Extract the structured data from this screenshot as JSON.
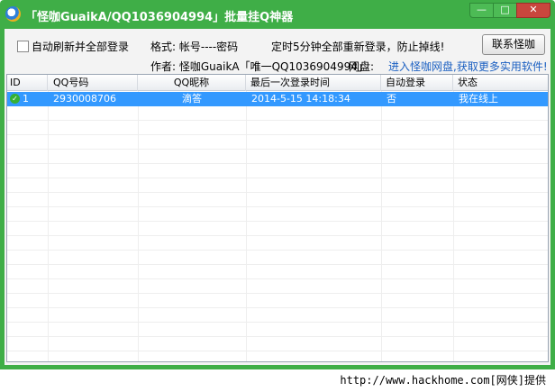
{
  "window": {
    "title": "「怪咖GuaikA/QQ1036904994」批量挂Q神器",
    "min_glyph": "—",
    "max_glyph": "□",
    "close_glyph": "✕"
  },
  "toolbar": {
    "auto_refresh_label": "自动刷新并全部登录",
    "format_text": "格式: 帐号----密码",
    "timer_text": "定时5分钟全部重新登录，防止掉线!",
    "contact_button": "联系怪咖",
    "author_text": "作者: 怪咖GuaikA「唯一QQ1036904994」",
    "disk_label": "网盘:",
    "disk_link": "进入怪咖网盘,获取更多实用软件!"
  },
  "table": {
    "columns": [
      "ID",
      "QQ号码",
      "QQ昵称",
      "最后一次登录时间",
      "自动登录",
      "状态"
    ],
    "rows": [
      {
        "id": "1",
        "qq": "2930008706",
        "nickname": "滴答",
        "last_login": "2014-5-15 14:18:34",
        "auto_login": "否",
        "status": "我在线上"
      }
    ]
  },
  "footer": {
    "text": "http://www.hackhome.com[网侠]提供"
  },
  "colors": {
    "frame": "#3fae47",
    "selection": "#3399ff",
    "link": "#1a5fc1"
  }
}
